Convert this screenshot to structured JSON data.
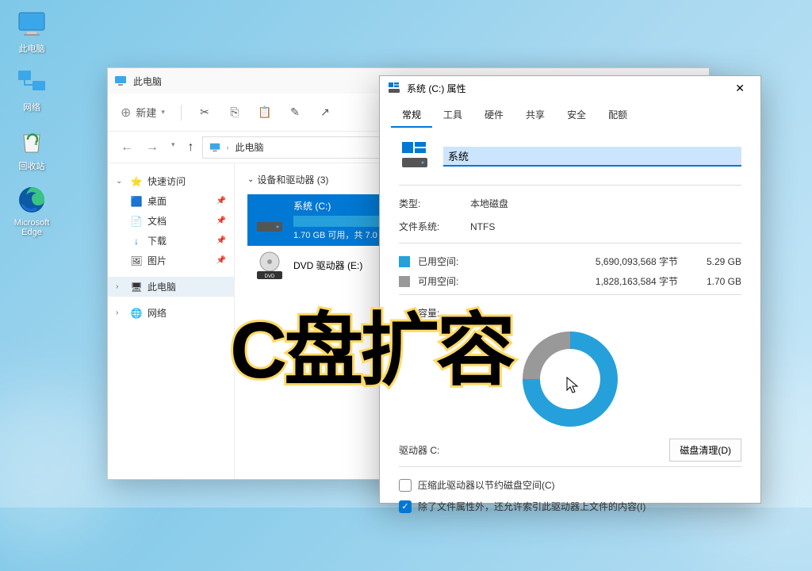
{
  "desktop": {
    "icons": [
      {
        "name": "此电脑",
        "type": "pc"
      },
      {
        "name": "网络",
        "type": "network"
      },
      {
        "name": "回收站",
        "type": "recycle"
      },
      {
        "name": "Microsoft Edge",
        "type": "edge"
      }
    ]
  },
  "explorer": {
    "title": "此电脑",
    "toolbar": {
      "new": "新建"
    },
    "path": "此电脑",
    "sidebar": {
      "quick_access": "快速访问",
      "items": [
        "桌面",
        "文档",
        "下载",
        "图片"
      ],
      "this_pc": "此电脑",
      "network": "网络"
    },
    "section_head": "设备和驱动器 (3)",
    "drives": [
      {
        "name": "系统 (C:)",
        "free_text": "1.70 GB 可用，共 7.0",
        "fill_pct": 76,
        "selected": true
      },
      {
        "name": "DVD 驱动器 (E:)",
        "free_text": "",
        "selected": false
      }
    ]
  },
  "props": {
    "title": "系统 (C:) 属性",
    "tabs": [
      "常规",
      "工具",
      "硬件",
      "共享",
      "安全",
      "配额"
    ],
    "name_value": "系统",
    "type_label": "类型:",
    "type_value": "本地磁盘",
    "fs_label": "文件系统:",
    "fs_value": "NTFS",
    "used_label": "已用空间:",
    "used_bytes": "5,690,093,568 字节",
    "used_size": "5.29 GB",
    "free_label": "可用空间:",
    "free_bytes": "1,828,163,584 字节",
    "free_size": "1.70 GB",
    "capacity_label": "容量:",
    "drive_label": "驱动器 C:",
    "cleanup_btn": "磁盘清理(D)",
    "compress_check": "压缩此驱动器以节约磁盘空间(C)",
    "index_check": "除了文件属性外，还允许索引此驱动器上文件的内容(I)"
  },
  "overlay": "C盘扩容",
  "colors": {
    "accent": "#0078d4",
    "used": "#26a0da",
    "free": "#999999"
  }
}
